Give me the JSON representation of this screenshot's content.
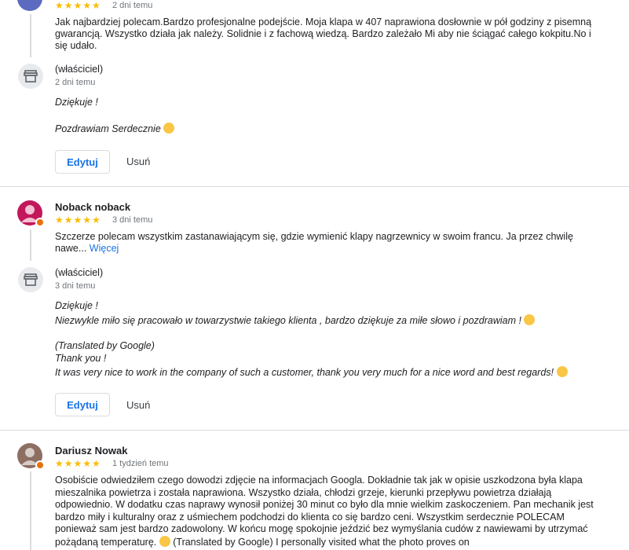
{
  "review1": {
    "stars": "★★★★★",
    "time": "2 dni temu",
    "text": "Jak najbardziej polecam.Bardzo profesjonalne podejście. Moja klapa w 407 naprawiona dosłownie w pół godziny z pisemną gwarancją. Wszystko działa jak należy. Solidnie i z fachową wiedzą. Bardzo zależało Mi aby nie ściągać całego kokpitu.No i się udało.",
    "owner_label": "(właściciel)",
    "owner_time": "2 dni temu",
    "reply_line1": "Dziękuje !",
    "reply_line2": "Pozdrawiam Serdecznie",
    "edit_label": "Edytuj",
    "delete_label": "Usuń"
  },
  "review2": {
    "author": "Noback noback",
    "stars": "★★★★★",
    "time": "3 dni temu",
    "text": "Szczerze polecam wszystkim zastanawiającym się, gdzie wymienić klapy nagrzewnicy w swoim francu. Ja przez chwilę nawe...",
    "more": "Więcej",
    "owner_label": "(właściciel)",
    "owner_time": "3 dni temu",
    "reply_line1": "Dziękuje !",
    "reply_line2": "Niezwykle miło się pracowało w towarzystwie takiego klienta , bardzo dziękuje za miłe słowo i pozdrawiam !",
    "translated_label": "(Translated by Google)",
    "translated_line1": "Thank you !",
    "translated_line2": "It was very nice to work in the company of such a customer, thank you very much for a nice word and best regards!",
    "edit_label": "Edytuj",
    "delete_label": "Usuń"
  },
  "review3": {
    "author": "Dariusz Nowak",
    "stars": "★★★★★",
    "time": "1 tydzień temu",
    "text": "Osobiście odwiedziłem czego dowodzi zdjęcie na informacjach Googla. Dokładnie tak jak w opisie uszkodzona była klapa mieszalnika powietrza i została naprawiona. Wszystko działa, chłodzi grzeje, kierunki przepływu powietrza działają odpowiednio. W dodatku czas naprawy wynosił poniżej 30 minut co było dla mnie wielkim zaskoczeniem. Pan mechanik jest bardzo miły i kulturalny oraz z uśmiechem podchodzi do klienta co się bardzo ceni. Wszystkim serdecznie POLECAM ponieważ sam jest bardzo zadowolony. W końcu mogę spokojnie jeździć bez wymyślania cudów z nawiewami by utrzymać pożądaną temperaturę.",
    "text_tail": "(Translated by Google) I personally visited what the photo proves on"
  },
  "colors": {
    "accent": "#1a73e8",
    "star": "#fbbc04",
    "avatar_noback": "#c2185b",
    "avatar_dariusz": "#8d6e63"
  }
}
